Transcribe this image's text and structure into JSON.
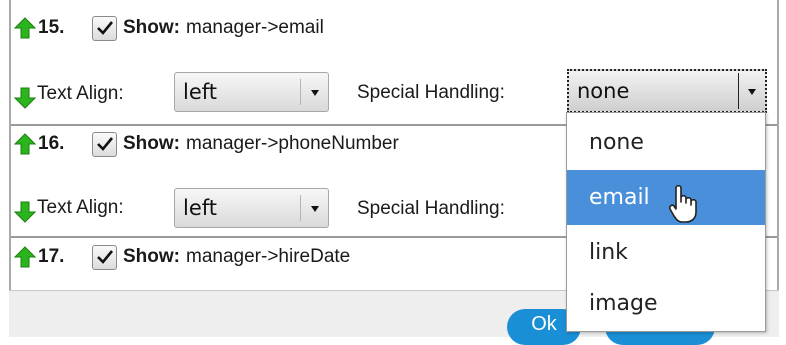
{
  "colors": {
    "arrow_green": "#2bb51d",
    "selection_blue": "#4a8fd9",
    "button_blue": "#1a8fd6"
  },
  "rows": [
    {
      "number": "15.",
      "show_label": "Show:",
      "field": "manager->email",
      "checked": true,
      "text_align_label": "Text Align:",
      "text_align_value": "left",
      "special_label": "Special Handling:",
      "special_value": "none"
    },
    {
      "number": "16.",
      "show_label": "Show:",
      "field": "manager->phoneNumber",
      "checked": true,
      "text_align_label": "Text Align:",
      "text_align_value": "left",
      "special_label": "Special Handling:"
    },
    {
      "number": "17.",
      "show_label": "Show:",
      "field": "manager->hireDate",
      "checked": true
    }
  ],
  "dropdown": {
    "options": [
      "none",
      "email",
      "link",
      "image"
    ],
    "highlighted": "email"
  },
  "footer": {
    "ok_label": "Ok"
  },
  "icons": {
    "up": "green-up-arrow-icon",
    "down": "green-down-arrow-icon",
    "check": "checkmark-icon",
    "cursor": "mouse-pointer-icon"
  }
}
